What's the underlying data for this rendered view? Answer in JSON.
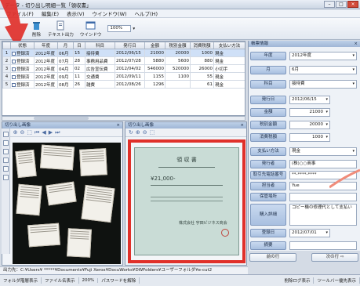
{
  "window": {
    "title": "データ - 切り出し明細一覧「領収書」"
  },
  "menu": [
    "ファイル(F)",
    "編集(E)",
    "表示(V)",
    "ウインドウ(W)",
    "ヘルプ(H)"
  ],
  "toolbar": {
    "delete_label": "削除",
    "text_export_label": "テキスト出力",
    "window_label": "ウインドウ",
    "zoom": "100%"
  },
  "table": {
    "headers": [
      "",
      "状態",
      "年度",
      "月",
      "日",
      "科目",
      "発行日",
      "金額",
      "税別金額",
      "消費税額",
      "支払い方法"
    ],
    "rows": [
      [
        "1",
        "登録済",
        "2012年度",
        "06月",
        "15",
        "接待費",
        "2012/06/15",
        "21000",
        "20000",
        "1000",
        "現金"
      ],
      [
        "2",
        "登録済",
        "2012年度",
        "07月",
        "28",
        "事務用品費",
        "2012/07/28",
        "5880",
        "5600",
        "880",
        "現金"
      ],
      [
        "3",
        "登録済",
        "2012年度",
        "04月",
        "02",
        "広告宣伝費",
        "2012/04/02",
        "546000",
        "520000",
        "26000",
        "小切手"
      ],
      [
        "4",
        "登録済",
        "2012年度",
        "09月",
        "11",
        "交通費",
        "2012/09/11",
        "1155",
        "1100",
        "55",
        "現金"
      ],
      [
        "5",
        "登録済",
        "2012年度",
        "08月",
        "26",
        "雑費",
        "2012/08/26",
        "1296",
        "",
        "61",
        "現金"
      ]
    ]
  },
  "panels": {
    "left_title": "切り出し画像",
    "right_title": "切り出し画像",
    "form_title": "帳票情報"
  },
  "receipt": {
    "title": "領 収 書",
    "amount": "¥21,000-",
    "shop": "株式会社 宇田ビジネス商会"
  },
  "form": [
    {
      "label": "年度",
      "value": "2012年度",
      "dropdown": true
    },
    {
      "label": "月",
      "value": "6月",
      "dropdown": true
    },
    {
      "label": "科目",
      "value": "接待費",
      "dropdown": true
    },
    {
      "label": "発行日",
      "value": "2012/06/15",
      "dropdown": true
    },
    {
      "label": "金額",
      "value": "21000",
      "dropdown": true
    },
    {
      "label": "税別金額",
      "value": "20000",
      "dropdown": true
    },
    {
      "label": "消費税額",
      "value": "1000",
      "dropdown": true
    },
    {
      "label": "支払い方法",
      "value": "現金",
      "dropdown": true
    },
    {
      "label": "発行者",
      "value": "(株)○○商事",
      "dropdown": false
    },
    {
      "label": "取引先電話番号",
      "value": "**-****-****",
      "dropdown": false
    },
    {
      "label": "担当者",
      "value": "Yue",
      "dropdown": false
    },
    {
      "label": "保管場所",
      "value": "",
      "dropdown": false
    },
    {
      "label": "購入詳細",
      "value": "コピー機の修理代として支払い",
      "dropdown": false
    },
    {
      "label": "登録日",
      "value": "2012/07/01",
      "dropdown": true
    },
    {
      "label": "摘要",
      "value": "",
      "dropdown": false
    }
  ],
  "nav": {
    "prev": "前の行",
    "next": "次の行"
  },
  "status": {
    "path": "出力先：C:¥Users¥ *****¥Documents¥Fuji Xerox¥DocuWorks¥DWFolders¥ユーザーフォルダ¥e-cut2",
    "items": [
      "フォルダ階層表示",
      "ファイル名表示",
      "200%",
      "パスワードを解除"
    ],
    "right_items": [
      "削除ログ表示",
      "ツールバー優先表示"
    ]
  },
  "colors": {
    "accent_red": "#e0302a",
    "selection": "#cfe0f7",
    "panel_header": "#a9c0e0",
    "receipt_bg": "#c9dcd6"
  }
}
